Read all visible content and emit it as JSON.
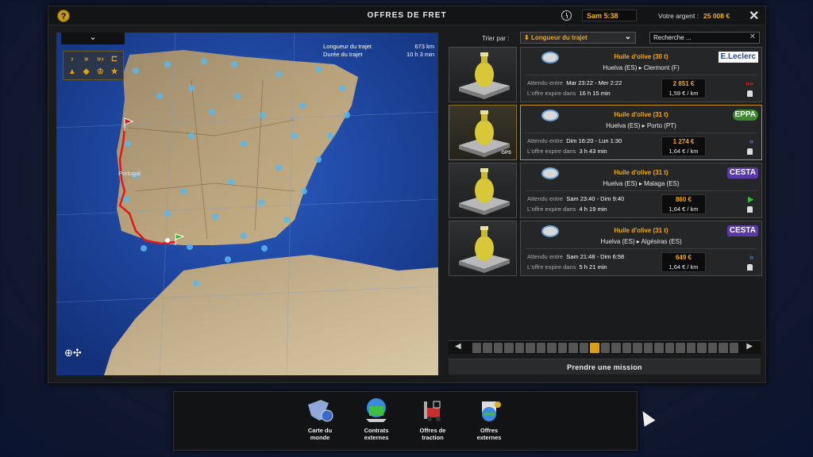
{
  "window": {
    "title": "OFFRES DE FRET",
    "help_icon": "question-icon",
    "time": "Sam 5:38",
    "money_label": "Votre argent :",
    "money_value": "25 008 €",
    "close_label": "✕"
  },
  "map": {
    "trip_length_label": "Longueur du trajet",
    "trip_length_value": "673 km",
    "trip_duration_label": "Durée du trajet",
    "trip_duration_value": "10 h 3 min",
    "country_label": "Portugal"
  },
  "sort": {
    "label": "Trier par :",
    "value": "Longueur du trajet",
    "search_value": "Recherche ..."
  },
  "offers": [
    {
      "cargo": "Huile d'olive (30 t)",
      "from": "Huelva (ES)",
      "to": "Clermont (F)",
      "wait_label": "Attendu entre",
      "wait_value": "Mar 23:22 - Mer 2:22",
      "expire_label": "L'offre expire dans",
      "expire_value": "16 h 15 min",
      "price": "2 851 €",
      "per_km": "1,59 € / km",
      "company": "E.Leclerc",
      "urgency": "triple-red-arrow",
      "selected": false
    },
    {
      "cargo": "Huile d'olive (31 t)",
      "from": "Huelva (ES)",
      "to": "Porto (PT)",
      "wait_label": "Attendu entre",
      "wait_value": "Dim 16:20 - Lun 1:30",
      "expire_label": "L'offre expire dans",
      "expire_value": "3 h 43 min",
      "price": "1 274 €",
      "per_km": "1,64 € / km",
      "company": "EPPA",
      "urgency": "double-blue-arrow",
      "selected": true,
      "gps": "GPS"
    },
    {
      "cargo": "Huile d'olive (31 t)",
      "from": "Huelva (ES)",
      "to": "Malaga (ES)",
      "wait_label": "Attendu entre",
      "wait_value": "Sam 23:40 - Dim 9:40",
      "expire_label": "L'offre expire dans",
      "expire_value": "4 h 19 min",
      "price": "860 €",
      "per_km": "1,64 € / km",
      "company": "CESTA",
      "urgency": "single-green-arrow",
      "selected": false
    },
    {
      "cargo": "Huile d'olive (31 t)",
      "from": "Huelva (ES)",
      "to": "Algésiras (ES)",
      "wait_label": "Attendu entre",
      "wait_value": "Sam 21:48 - Dim 6:58",
      "expire_label": "L'offre expire dans",
      "expire_value": "5 h 21 min",
      "price": "649 €",
      "per_km": "1,64 € / km",
      "company": "CESTA",
      "urgency": "double-blue-arrow",
      "selected": false
    }
  ],
  "take_mission": "Prendre une mission",
  "dock": [
    {
      "line1": "Carte du",
      "line2": "monde",
      "icon": "world-map-icon"
    },
    {
      "line1": "Contrats",
      "line2": "externes",
      "icon": "external-contracts-icon"
    },
    {
      "line1": "Offres de",
      "line2": "traction",
      "icon": "forklift-icon"
    },
    {
      "line1": "Offres",
      "line2": "externes",
      "icon": "external-offers-icon"
    }
  ],
  "colors": {
    "accent": "#f0a818",
    "selected_border": "#c9951c",
    "route": "#e01818"
  }
}
